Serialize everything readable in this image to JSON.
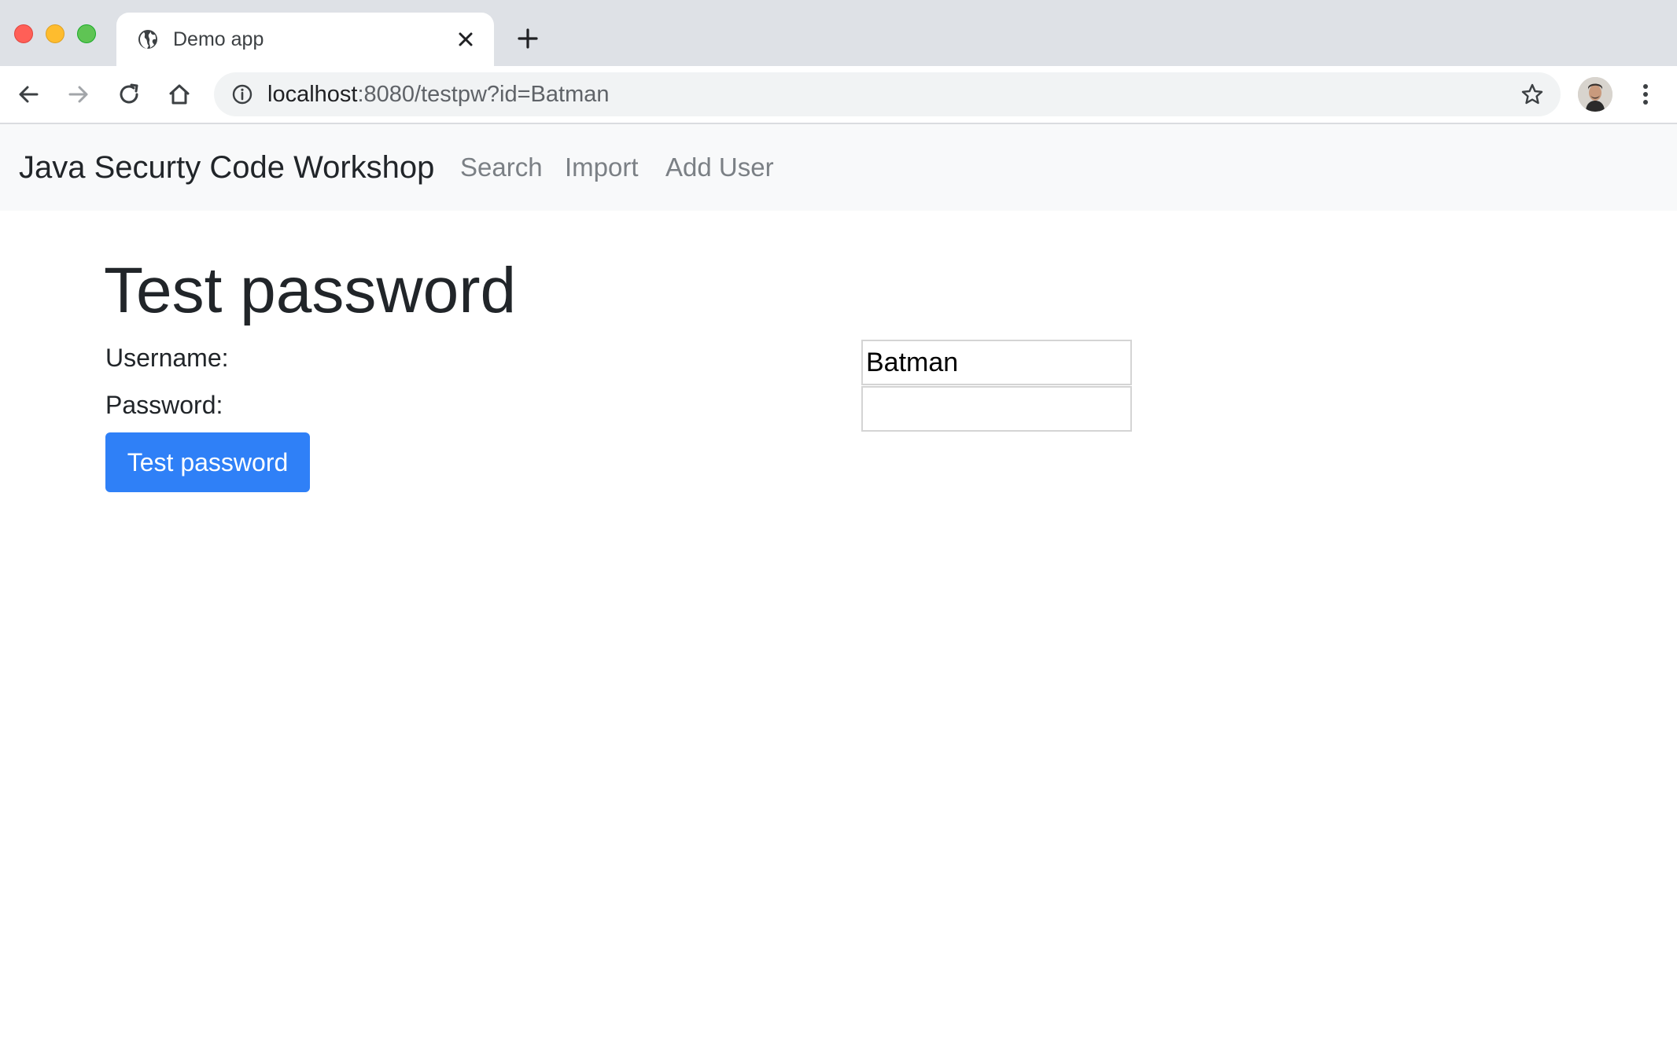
{
  "browser": {
    "tab_title": "Demo app",
    "url_host": "localhost",
    "url_rest": ":8080/testpw?id=Batman",
    "icons": [
      "close-window",
      "minimize-window",
      "zoom-window",
      "globe-icon",
      "close-icon",
      "plus-icon",
      "back-arrow-icon",
      "forward-arrow-icon",
      "reload-icon",
      "home-icon",
      "info-icon",
      "star-icon",
      "avatar",
      "kebab-menu-icon"
    ]
  },
  "navbar": {
    "brand": "Java Securty Code Workshop",
    "links": [
      "Search",
      "Import",
      "Add User"
    ]
  },
  "main": {
    "heading": "Test password",
    "username_label": "Username:",
    "password_label": "Password:",
    "username_value": "Batman",
    "password_value": "",
    "submit_label": "Test password"
  },
  "colors": {
    "primary_button": "#2f80f7",
    "navbar_bg": "#f8f9fa",
    "tabstrip_bg": "#dee1e6"
  }
}
